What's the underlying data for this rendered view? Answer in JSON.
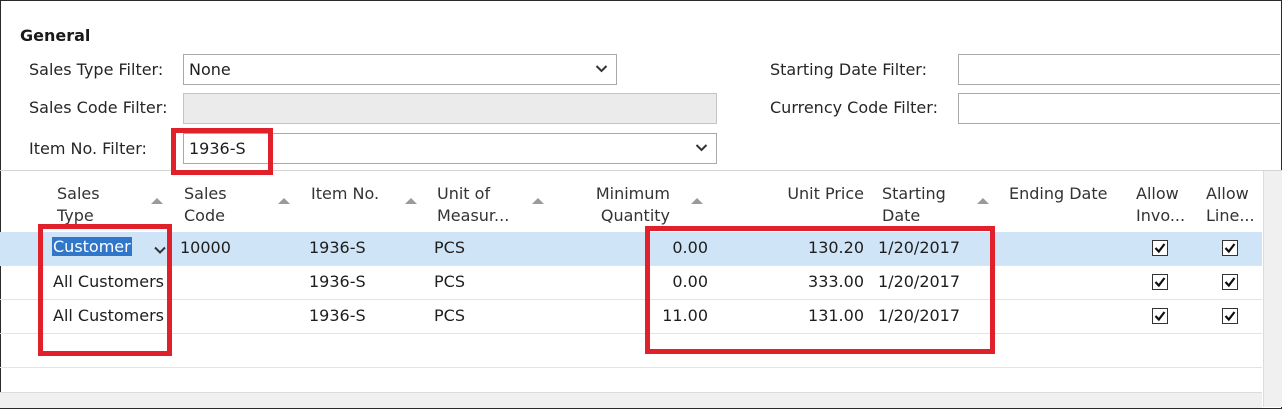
{
  "section": {
    "title": "General"
  },
  "filters": {
    "sales_type": {
      "label": "Sales Type Filter:",
      "value": "None"
    },
    "sales_code": {
      "label": "Sales Code Filter:",
      "value": ""
    },
    "item_no": {
      "label": "Item No. Filter:",
      "value": "1936-S"
    },
    "starting_date": {
      "label": "Starting Date Filter:",
      "value": ""
    },
    "currency_code": {
      "label": "Currency Code Filter:",
      "value": ""
    }
  },
  "columns": {
    "sales_type": {
      "line1": "Sales",
      "line2": "Type"
    },
    "sales_code": {
      "line1": "Sales",
      "line2": "Code"
    },
    "item_no": {
      "line1": "Item No.",
      "line2": ""
    },
    "uom": {
      "line1": "Unit of",
      "line2": "Measur..."
    },
    "min_qty": {
      "line1": "Minimum",
      "line2": "Quantity"
    },
    "unit_price": {
      "line1": "Unit Price",
      "line2": ""
    },
    "starting_date": {
      "line1": "Starting",
      "line2": "Date"
    },
    "ending_date": {
      "line1": "Ending Date",
      "line2": ""
    },
    "allow_inv": {
      "line1": "Allow",
      "line2": "Invo..."
    },
    "allow_line": {
      "line1": "Allow",
      "line2": "Line..."
    }
  },
  "rows": [
    {
      "sales_type": "Customer",
      "sales_code": "10000",
      "item_no": "1936-S",
      "uom": "PCS",
      "min_qty": "0.00",
      "unit_price": "130.20",
      "starting_date": "1/20/2017",
      "ending_date": "",
      "allow_inv": true,
      "allow_line": true
    },
    {
      "sales_type": "All Customers",
      "sales_code": "",
      "item_no": "1936-S",
      "uom": "PCS",
      "min_qty": "0.00",
      "unit_price": "333.00",
      "starting_date": "1/20/2017",
      "ending_date": "",
      "allow_inv": true,
      "allow_line": true
    },
    {
      "sales_type": "All Customers",
      "sales_code": "",
      "item_no": "1936-S",
      "uom": "PCS",
      "min_qty": "11.00",
      "unit_price": "131.00",
      "starting_date": "1/20/2017",
      "ending_date": "",
      "allow_inv": true,
      "allow_line": true
    }
  ],
  "colors": {
    "highlight": "#e0202a",
    "selected_row": "#cfe4f6",
    "selected_text": "#3177c9"
  }
}
